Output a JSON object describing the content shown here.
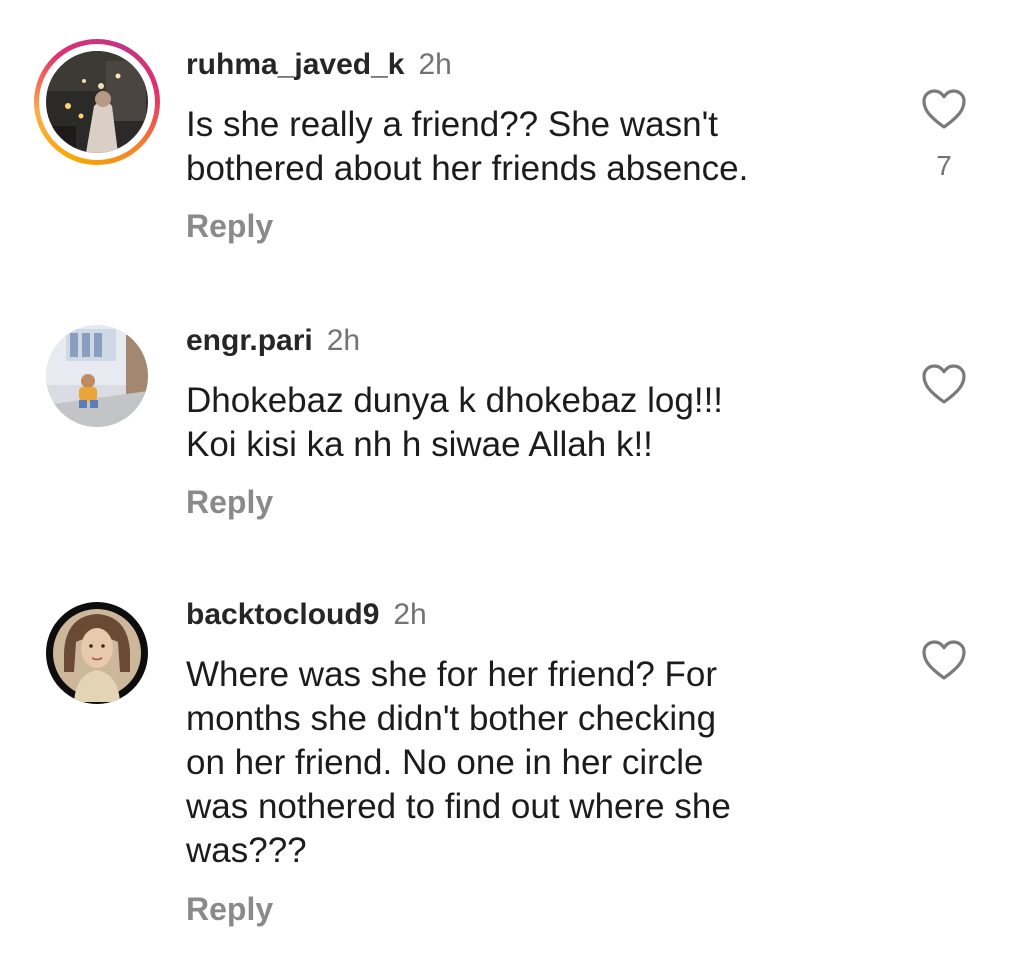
{
  "comments": [
    {
      "username": "ruhma_javed_k",
      "time": "2h",
      "text": "Is she really a friend?? She wasn't\nbothered about her friends absence.",
      "reply": "Reply",
      "likes": "7",
      "avatar_icon": "profile-photo-candles",
      "has_story_ring": true
    },
    {
      "username": "engr.pari",
      "time": "2h",
      "text": "Dhokebaz dunya k dhokebaz log!!!\nKoi kisi ka nh h siwae Allah k!!",
      "reply": "Reply",
      "likes": "",
      "avatar_icon": "profile-photo-child-outdoors",
      "has_story_ring": false
    },
    {
      "username": "backtocloud9",
      "time": "2h",
      "text": "Where was she for her friend? For\nmonths she didn't bother checking\non her friend. No one in her circle\nwas nothered to find out where she\nwas???",
      "reply": "Reply",
      "likes": "",
      "avatar_icon": "profile-photo-woman",
      "has_story_ring": false
    }
  ],
  "icons": {
    "like": "heart-outline-icon"
  },
  "colors": {
    "story_ring_start": "#f9a603",
    "story_ring_end": "#c13584",
    "reply": "#8a8a8a",
    "time": "#737373"
  }
}
